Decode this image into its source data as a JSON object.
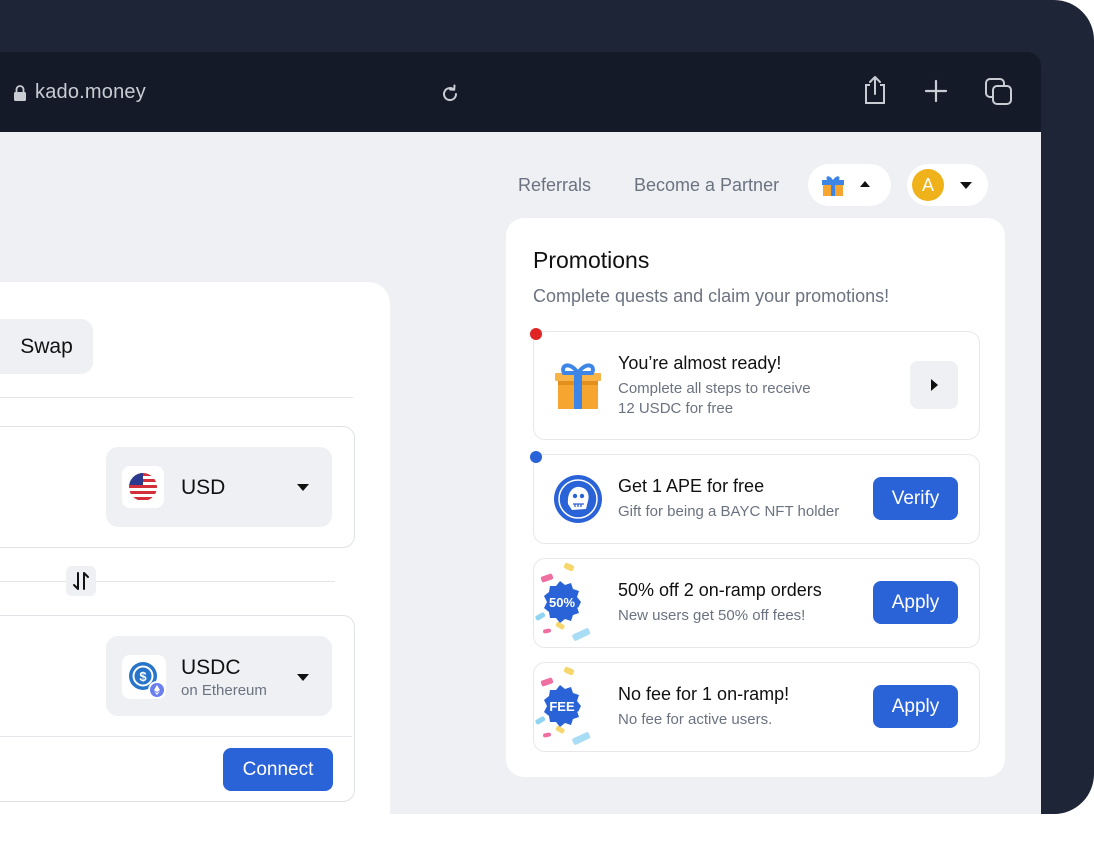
{
  "browser": {
    "url": "kado.money"
  },
  "nav": {
    "referrals": "Referrals",
    "partner": "Become a Partner",
    "avatar_letter": "A"
  },
  "swap": {
    "tab_label": "Swap",
    "from_currency": "USD",
    "to_currency": "USDC",
    "to_network": "on Ethereum",
    "connect_label": "Connect"
  },
  "promotions": {
    "title": "Promotions",
    "subtitle": "Complete quests and claim your promotions!",
    "items": [
      {
        "title": "You’re almost ready!",
        "desc_line1": "Complete all steps to receive",
        "desc_line2": "12 USDC for free",
        "dot_color": "#e02424"
      },
      {
        "title": "Get 1 APE for free",
        "desc": "Gift for being a BAYC NFT holder",
        "button": "Verify",
        "dot_color": "#2a62d8"
      },
      {
        "title": "50% off 2 on-ramp orders",
        "desc": "New users get 50% off fees!",
        "button": "Apply",
        "badge": "50%"
      },
      {
        "title": "No fee for 1 on-ramp!",
        "desc": "No fee for active users.",
        "button": "Apply",
        "badge": "FEE"
      }
    ]
  },
  "colors": {
    "frame": "#1e2536",
    "accent": "#2a62d8",
    "avatar": "#f0b21b"
  }
}
